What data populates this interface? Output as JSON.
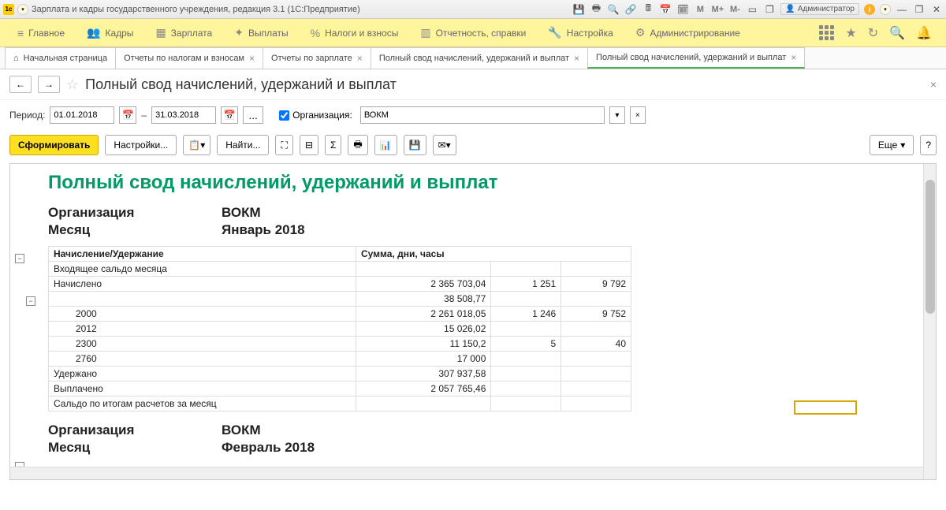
{
  "titlebar": {
    "title": "Зарплата и кадры государственного учреждения, редакция 3.1  (1С:Предприятие)",
    "admin": "Администратор",
    "icons": {
      "m1": "M",
      "m2": "M+",
      "m3": "M-"
    }
  },
  "nav": {
    "items": [
      {
        "icon": "≡",
        "label": "Главное"
      },
      {
        "icon": "👥",
        "label": "Кадры"
      },
      {
        "icon": "▦",
        "label": "Зарплата"
      },
      {
        "icon": "✦",
        "label": "Выплаты"
      },
      {
        "icon": "%",
        "label": "Налоги и взносы"
      },
      {
        "icon": "▥",
        "label": "Отчетность, справки"
      },
      {
        "icon": "🔧",
        "label": "Настройка"
      },
      {
        "icon": "⚙",
        "label": "Администрирование"
      }
    ]
  },
  "tabs": [
    {
      "icon": "⌂",
      "label": "Начальная страница",
      "close": false
    },
    {
      "label": "Отчеты по налогам и взносам",
      "close": true
    },
    {
      "label": "Отчеты по зарплате",
      "close": true
    },
    {
      "label": "Полный свод начислений, удержаний и выплат",
      "close": true
    },
    {
      "label": "Полный свод начислений, удержаний и выплат",
      "close": true,
      "active": true
    }
  ],
  "page": {
    "title": "Полный свод начислений, удержаний и выплат"
  },
  "filters": {
    "period_label": "Период:",
    "date_from": "01.01.2018",
    "date_to": "31.03.2018",
    "dash": "–",
    "org_chk": true,
    "org_label": "Организация:",
    "org_value": "ВОКМ"
  },
  "toolbar": {
    "generate": "Сформировать",
    "settings": "Настройки...",
    "find": "Найти...",
    "more": "Еще"
  },
  "report": {
    "title": "Полный свод начислений, удержаний и выплат",
    "org_label": "Организация",
    "month_label": "Месяц",
    "blocks": [
      {
        "org": "ВОКМ",
        "month": "Январь 2018"
      },
      {
        "org": "ВОКМ",
        "month": "Февраль 2018"
      }
    ],
    "headers": {
      "col1": "Начисление/Удержание",
      "col2": "Сумма, дни, часы"
    },
    "rows": [
      {
        "label": "Входящее сальдо месяца",
        "sum": "",
        "days": "",
        "hours": ""
      },
      {
        "label": "Начислено",
        "sum": "2 365 703,04",
        "days": "1 251",
        "hours": "9 792",
        "bold": true
      },
      {
        "label": "",
        "sum": "38 508,77",
        "days": "",
        "hours": "",
        "indent": 2
      },
      {
        "label": "2000",
        "sum": "2 261 018,05",
        "days": "1 246",
        "hours": "9 752",
        "indent": 2
      },
      {
        "label": "2012",
        "sum": "15 026,02",
        "days": "",
        "hours": "",
        "indent": 2
      },
      {
        "label": "2300",
        "sum": "11 150,2",
        "days": "5",
        "hours": "40",
        "indent": 2
      },
      {
        "label": "2760",
        "sum": "17 000",
        "days": "",
        "hours": "",
        "indent": 2
      },
      {
        "label": "Удержано",
        "sum": "307 937,58",
        "days": "",
        "hours": "",
        "bold": true
      },
      {
        "label": "Выплачено",
        "sum": "2 057 765,46",
        "days": "",
        "hours": "",
        "bold": true
      },
      {
        "label": "Сальдо по итогам расчетов за месяц",
        "sum": "",
        "days": "",
        "hours": "",
        "bold": true
      }
    ]
  }
}
